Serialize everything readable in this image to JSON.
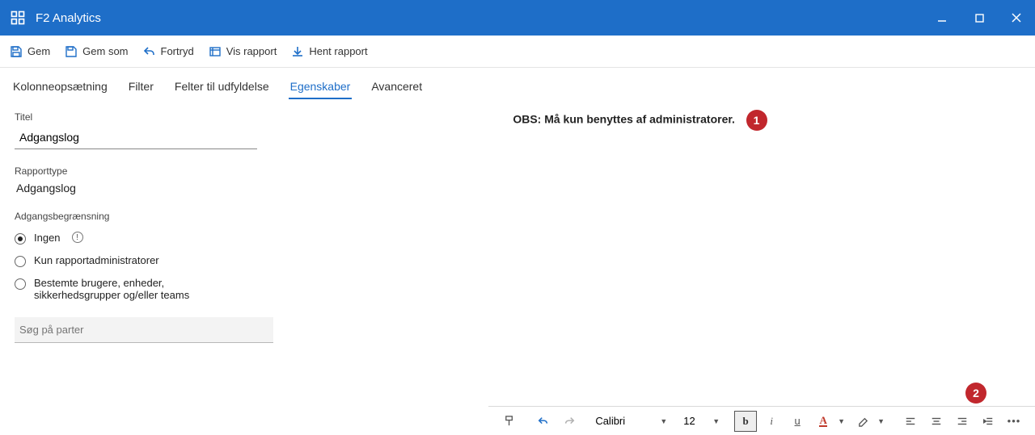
{
  "app": {
    "title": "F2 Analytics"
  },
  "toolbar": {
    "save": "Gem",
    "save_as": "Gem som",
    "undo": "Fortryd",
    "show_report": "Vis rapport",
    "download_report": "Hent rapport"
  },
  "tabs": {
    "col_setup": "Kolonneopsætning",
    "filter": "Filter",
    "fields": "Felter til udfyldelse",
    "properties": "Egenskaber",
    "advanced": "Avanceret"
  },
  "form": {
    "title_label": "Titel",
    "title_value": "Adgangslog",
    "reporttype_label": "Rapporttype",
    "reporttype_value": "Adgangslog",
    "access_label": "Adgangsbegrænsning",
    "radio_none": "Ingen",
    "radio_admins": "Kun rapportadministratorer",
    "radio_specific": "Bestemte brugere, enheder, sikkerhedsgrupper og/eller teams",
    "search_placeholder": "Søg på parter"
  },
  "editor": {
    "note": "OBS: Må kun benyttes af administratorer.",
    "badge1": "1",
    "badge2": "2",
    "font": "Calibri",
    "size": "12"
  }
}
